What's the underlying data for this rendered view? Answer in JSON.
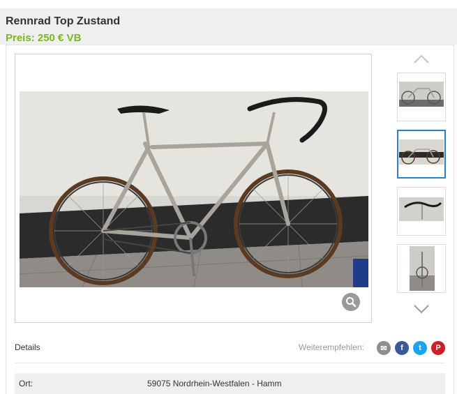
{
  "listing": {
    "title": "Rennrad Top Zustand",
    "price": "Preis: 250 € VB"
  },
  "gallery": {
    "main_image_alt": "Rennrad",
    "zoom_icon": "magnifier-icon",
    "thumbnails_count": 4,
    "active_thumbnail": 2
  },
  "details": {
    "label": "Details",
    "share_label": "Weiterempfehlen:",
    "share_buttons": [
      {
        "name": "email",
        "glyph": "✉",
        "color": "#8e8e8e"
      },
      {
        "name": "facebook",
        "glyph": "f",
        "color": "#3b5998"
      },
      {
        "name": "twitter",
        "glyph": "t",
        "color": "#1da1f2"
      },
      {
        "name": "pinterest",
        "glyph": "P",
        "color": "#cb2027"
      }
    ]
  },
  "attributes": [
    {
      "key": "Ort:",
      "value": "59075 Nordrhein-Westfalen - Hamm"
    }
  ],
  "colors": {
    "price_green": "#7ab81b",
    "active_border": "#2d7fc1"
  }
}
